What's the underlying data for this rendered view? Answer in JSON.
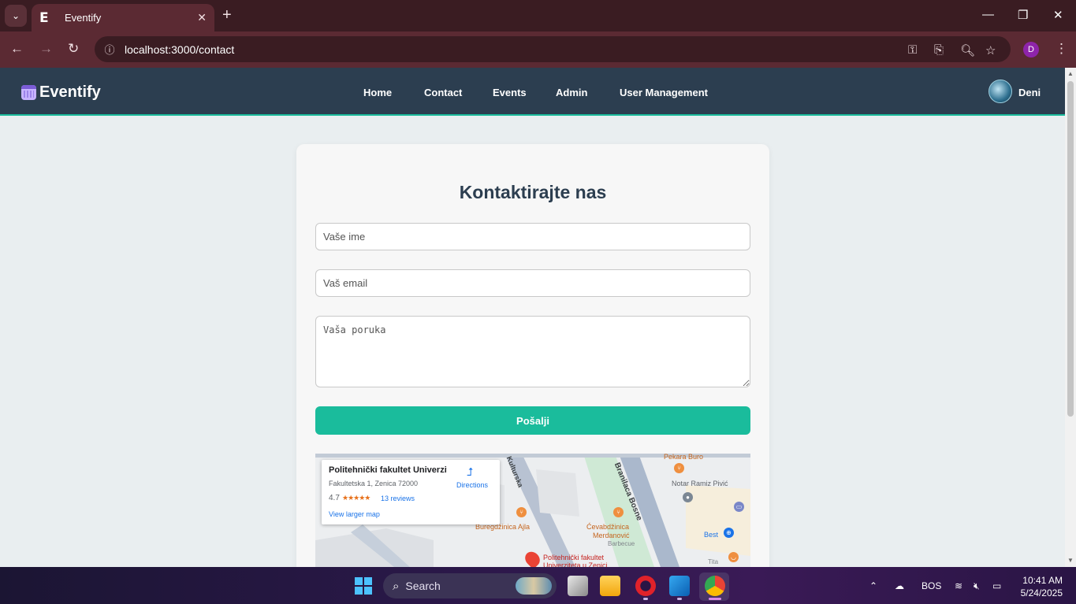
{
  "browser": {
    "tab_title": "Eventify",
    "tab_favicon": "E",
    "url": "localhost:3000/contact",
    "profile_initial": "D"
  },
  "site": {
    "brand": "Eventify",
    "nav": [
      "Home",
      "Contact",
      "Events",
      "Admin",
      "User Management"
    ],
    "username": "Deni",
    "accent_color": "#1abc9c",
    "navbar_color": "#2c3e50"
  },
  "contact": {
    "title": "Kontaktirajte nas",
    "name_placeholder": "Vaše ime",
    "email_placeholder": "Vaš email",
    "message_placeholder": "Vaša poruka",
    "submit_label": "Pošalji"
  },
  "map": {
    "place_name": "Politehnički fakultet Univerzit...",
    "address": "Fakultetska 1, Zenica 72000",
    "rating": "4.7",
    "stars": "★★★★★",
    "reviews": "13 reviews",
    "directions": "Directions",
    "larger_map": "View larger map",
    "labels": {
      "pekara": "Pekara Buro",
      "notar": "Notar Ramiz Pivić",
      "buregdzinica": "Buregdžinica Ajla",
      "cevabdzinica": "Ćevabdžinica",
      "merdanovic": "Merdanović",
      "barbecue": "Barbecue",
      "best": "Best",
      "street1": "Branilaca Bosne",
      "street2": "Kulturska",
      "poli1": "Politehnički fakultet",
      "poli2": "Univerziteta u Zenici",
      "tita": "Tita"
    }
  },
  "taskbar": {
    "search_label": "Search",
    "language": "BOS",
    "time": "10:41 AM",
    "date": "5/24/2025"
  }
}
